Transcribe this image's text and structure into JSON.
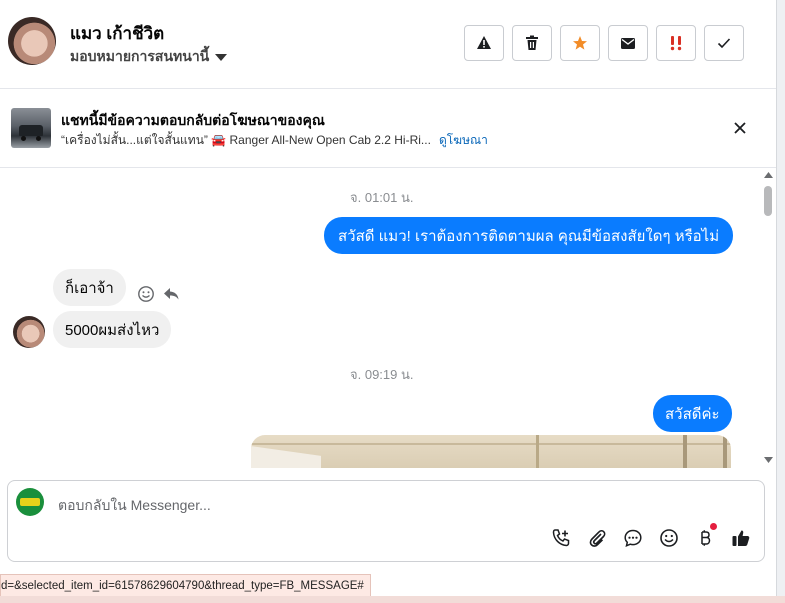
{
  "header": {
    "name": "แมว เก้าชีวิต",
    "assign_label": "มอบหมายการสนทนานี้",
    "toolbar": [
      {
        "name": "report-icon",
        "glyph": "⚠"
      },
      {
        "name": "trash-icon",
        "glyph": "🗑"
      },
      {
        "name": "star-icon",
        "glyph": "★",
        "color": "#f28c28"
      },
      {
        "name": "mail-icon",
        "glyph": "✉"
      },
      {
        "name": "important-icon",
        "glyph": "‼",
        "color": "#d93025"
      },
      {
        "name": "check-icon",
        "glyph": "✓"
      }
    ]
  },
  "ad": {
    "title": "แชทนี้มีข้อความตอบกลับต่อโฆษณาของคุณ",
    "subtitle": "“เครื่องไม่สั้น...แต่ใจสั้นแทน” 🚘 Ranger All-New Open Cab 2.2 Hi-Ri...",
    "link": "ดูโฆษณา"
  },
  "chat": {
    "timestamp1": "จ. 01:01 น.",
    "msg_out_1": "สวัสดี แมว! เราต้องการติดตามผล คุณมีข้อสงสัยใดๆ หรือไม่",
    "msg_in_1": "ก็เอาจ้า",
    "msg_in_2": "5000ผมส่งไหว",
    "timestamp2": "จ. 09:19 น.",
    "msg_out_2": "สวัสดีค่ะ"
  },
  "composer": {
    "placeholder": "ตอบกลับใน Messenger...",
    "icons": [
      "phone-add-icon",
      "attachment-icon",
      "saved-reply-icon",
      "emoji-icon",
      "payment-icon",
      "like-icon"
    ]
  },
  "statusbar": {
    "url": "d=&selected_item_id=61578629604790&thread_type=FB_MESSAGE#"
  },
  "colors": {
    "accent": "#0a7cff",
    "link": "#0866b8"
  }
}
